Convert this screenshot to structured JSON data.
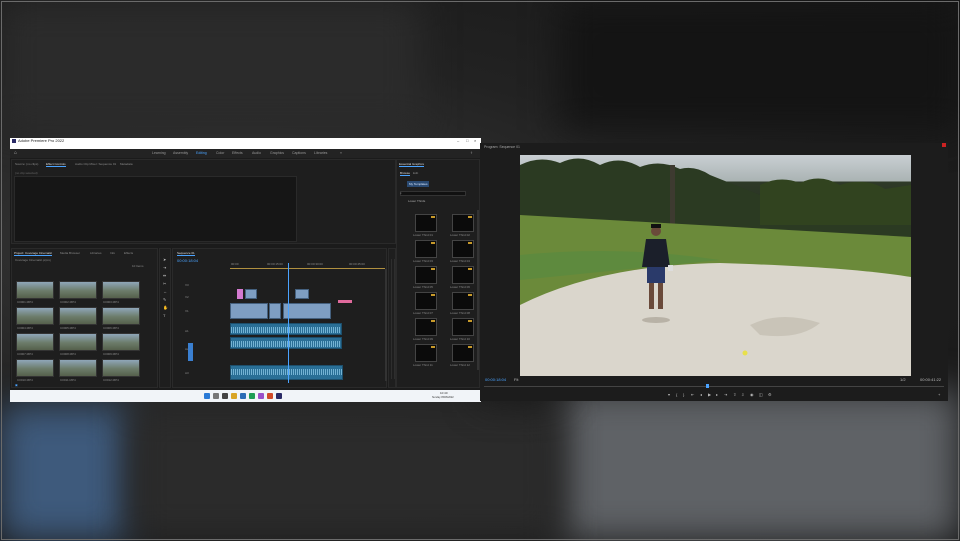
{
  "premiere": {
    "app_title": "Adobe Premiere Pro 2022",
    "menu": [
      "File",
      "Edit",
      "Clip",
      "Sequence",
      "Markers",
      "Graphics",
      "View",
      "Window",
      "Help"
    ],
    "workspaces": [
      "Learning",
      "Assembly",
      "Editing",
      "Color",
      "Effects",
      "Audio",
      "Graphics",
      "Captions",
      "Libraries"
    ],
    "active_workspace": "Editing",
    "source_tabs": [
      "Source: (no clips)",
      "Effect Controls",
      "Audio Clip Mixer: Sequence 01",
      "Metadata"
    ],
    "source_empty": "(no clip selected)",
    "project": {
      "tabs": [
        "Project: Coverage Cinematic",
        "Media Browser",
        "Libraries",
        "Info",
        "Effects"
      ],
      "path": "Coverage Cinematic.prproj",
      "count": "10 Items",
      "clips": [
        {
          "name": "C0001.MP4",
          "dur": "12:14"
        },
        {
          "name": "C0002.MP4",
          "dur": "8:03"
        },
        {
          "name": "C0003.MP4",
          "dur": "10:20"
        },
        {
          "name": "C0004.MP4",
          "dur": "6:11"
        },
        {
          "name": "C0005.MP4",
          "dur": "9:02"
        },
        {
          "name": "C0006.MP4",
          "dur": "5:18"
        },
        {
          "name": "C0007.MP4",
          "dur": "7:05"
        },
        {
          "name": "C0008.MP4",
          "dur": "4:22"
        },
        {
          "name": "C0009.MP4",
          "dur": "11:00"
        },
        {
          "name": "C0010.MP4",
          "dur": "3:14"
        },
        {
          "name": "C0011.MP4",
          "dur": "6:09"
        },
        {
          "name": "C0012.MP4",
          "dur": "8:16"
        }
      ]
    },
    "timeline": {
      "tab": "Sequence 01",
      "timecode": "00:00:18:04",
      "ruler": [
        "00:00",
        "00:00:15:00",
        "00:00:30:00",
        "00:00:45:00"
      ],
      "tracks": [
        "V3",
        "V2",
        "V1",
        "A1",
        "A2",
        "A3"
      ]
    },
    "essential_graphics": {
      "title": "Essential Graphics",
      "tabs": [
        "Browse",
        "Edit"
      ],
      "button": "My Templates",
      "filter": "Lower Thirds",
      "items": [
        "Lower Third 01",
        "Lower Third 02",
        "Lower Third 03",
        "Lower Third 04",
        "Lower Third 05",
        "Lower Third 06",
        "Lower Third 07",
        "Lower Third 08",
        "Lower Third 09",
        "Lower Third 10",
        "Lower Third 11",
        "Lower Third 12"
      ]
    },
    "clock": {
      "time": "10:40",
      "date": "Sunday 05/06/2022"
    }
  },
  "program_monitor": {
    "title": "Program: Sequence 01",
    "timecode_in": "00:00:18:04",
    "fit": "Fit",
    "quality": "1/2",
    "timecode_total": "00:00:41:22"
  },
  "colors": {
    "accent": "#4aa3ff",
    "panel": "#1e1e1e",
    "taskbar": "#f1f4f8"
  }
}
